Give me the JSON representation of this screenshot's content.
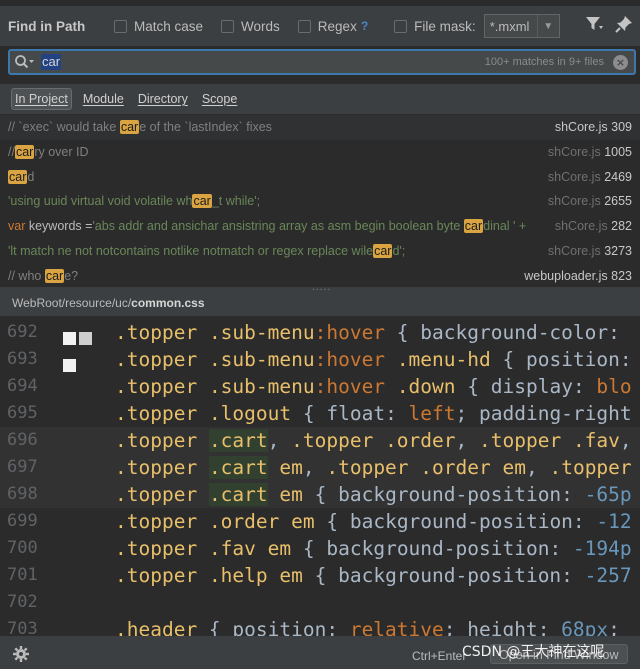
{
  "toolbar": {
    "title": "Find in Path",
    "match_case": "Match case",
    "words": "Words",
    "regex": "Regex",
    "regex_help": "?",
    "file_mask": "File mask:",
    "file_mask_value": "*.mxml"
  },
  "search": {
    "query": "car",
    "match_count": "100+ matches in 9+ files"
  },
  "scopes": [
    "In Project",
    "Module",
    "Directory",
    "Scope"
  ],
  "results": [
    {
      "before": "// `exec` would take ",
      "match": "car",
      "after": "e of the `lastIndex` fixes",
      "style": "comment",
      "file": "shCore.js",
      "line": "309",
      "file_style": "bright"
    },
    {
      "before": "//",
      "match": "car",
      "after": "ry over ID",
      "style": "comment",
      "file": "shCore.js",
      "line": "1005",
      "file_style": "dim"
    },
    {
      "before": "",
      "match": "car",
      "after": "d",
      "style": "comment",
      "file": "shCore.js",
      "line": "2469",
      "file_style": "dim"
    },
    {
      "before": "'using uuid virtual void volatile wh",
      "match": "car",
      "after": "_t while';",
      "style": "string",
      "file": "shCore.js",
      "line": "2655",
      "file_style": "dim"
    },
    {
      "before_kw": "var",
      "before_plain": " keywords =",
      "before": "'abs addr and ansichar ansistring array as asm begin boolean byte ",
      "match": "car",
      "after": "dinal ' + ",
      "style": "mixed",
      "file": "shCore.js",
      "line": "282",
      "file_style": "dim"
    },
    {
      "before": "'lt match ne not notcontains notlike notmatch or regex replace wile",
      "match": "car",
      "after": "d';",
      "style": "string",
      "file": "shCore.js",
      "line": "3273",
      "file_style": "dim"
    },
    {
      "before": "// who ",
      "match": "car",
      "after": "e?",
      "style": "comment",
      "file": "webuploader.js",
      "line": "823",
      "file_style": "bright"
    }
  ],
  "preview": {
    "path_prefix": "WebRoot/resource/uc/",
    "path_file": "common.css"
  },
  "code_lines": [
    {
      "n": "692",
      "marks": [
        "white",
        "grey"
      ]
    },
    {
      "n": "693",
      "marks": [
        "white"
      ]
    },
    {
      "n": "694",
      "marks": []
    },
    {
      "n": "695",
      "marks": []
    },
    {
      "n": "696",
      "marks": []
    },
    {
      "n": "697",
      "marks": []
    },
    {
      "n": "698",
      "marks": []
    },
    {
      "n": "699",
      "marks": []
    },
    {
      "n": "700",
      "marks": []
    },
    {
      "n": "701",
      "marks": []
    },
    {
      "n": "702",
      "marks": []
    },
    {
      "n": "703",
      "marks": []
    }
  ],
  "code": {
    "l692": [
      ".topper",
      ".sub-menu",
      ":hover",
      " { ",
      "background-color",
      ":"
    ],
    "l693": [
      ".topper",
      ".sub-menu",
      ":hover",
      ".menu-hd",
      " { ",
      "position",
      ":"
    ],
    "l694": [
      ".topper",
      ".sub-menu",
      ":hover",
      ".down",
      " { ",
      "display",
      ": ",
      "blo"
    ],
    "l695": [
      ".topper",
      ".logout",
      " { ",
      "float",
      ": ",
      "left",
      "; ",
      "padding-right"
    ],
    "l696": [
      ".topper",
      ".cart",
      ", ",
      ".topper",
      ".order",
      ", ",
      ".topper",
      ".fav",
      ","
    ],
    "l697": [
      ".topper",
      ".cart",
      "em",
      ", ",
      ".topper",
      ".order",
      "em",
      ", ",
      ".topper"
    ],
    "l698": [
      ".topper",
      ".cart",
      "em",
      " { ",
      "background-position",
      ": ",
      "-65p"
    ],
    "l699": [
      ".topper",
      ".order",
      "em",
      " { ",
      "background-position",
      ": ",
      "-12"
    ],
    "l700": [
      ".topper",
      ".fav",
      "em",
      " { ",
      "background-position",
      ": ",
      "-194p"
    ],
    "l701": [
      ".topper",
      ".help",
      "em",
      " { ",
      "background-position",
      ": ",
      "-257"
    ],
    "l703": [
      ".header",
      " { ",
      "position",
      ": ",
      "relative",
      "; ",
      "height",
      ": ",
      "68px",
      ";"
    ]
  },
  "bottom": {
    "shortcut": "Ctrl+Enter",
    "open_button": "Open in Find Window",
    "watermark": "CSDN @王大神在这呢"
  },
  "colors": {
    "background": "#2b2b2b",
    "panel": "#3c3f41",
    "search_border": "#3d78ad",
    "match_highlight": "#d9a441",
    "string": "#6a8759",
    "keyword": "#cc7832",
    "comment": "#808080",
    "css_selector": "#e8bf6a",
    "number": "#6897bb"
  },
  "icons": [
    "filter-icon",
    "pin-icon",
    "search-icon",
    "clear-icon",
    "gear-icon",
    "dropdown-arrow-icon"
  ]
}
